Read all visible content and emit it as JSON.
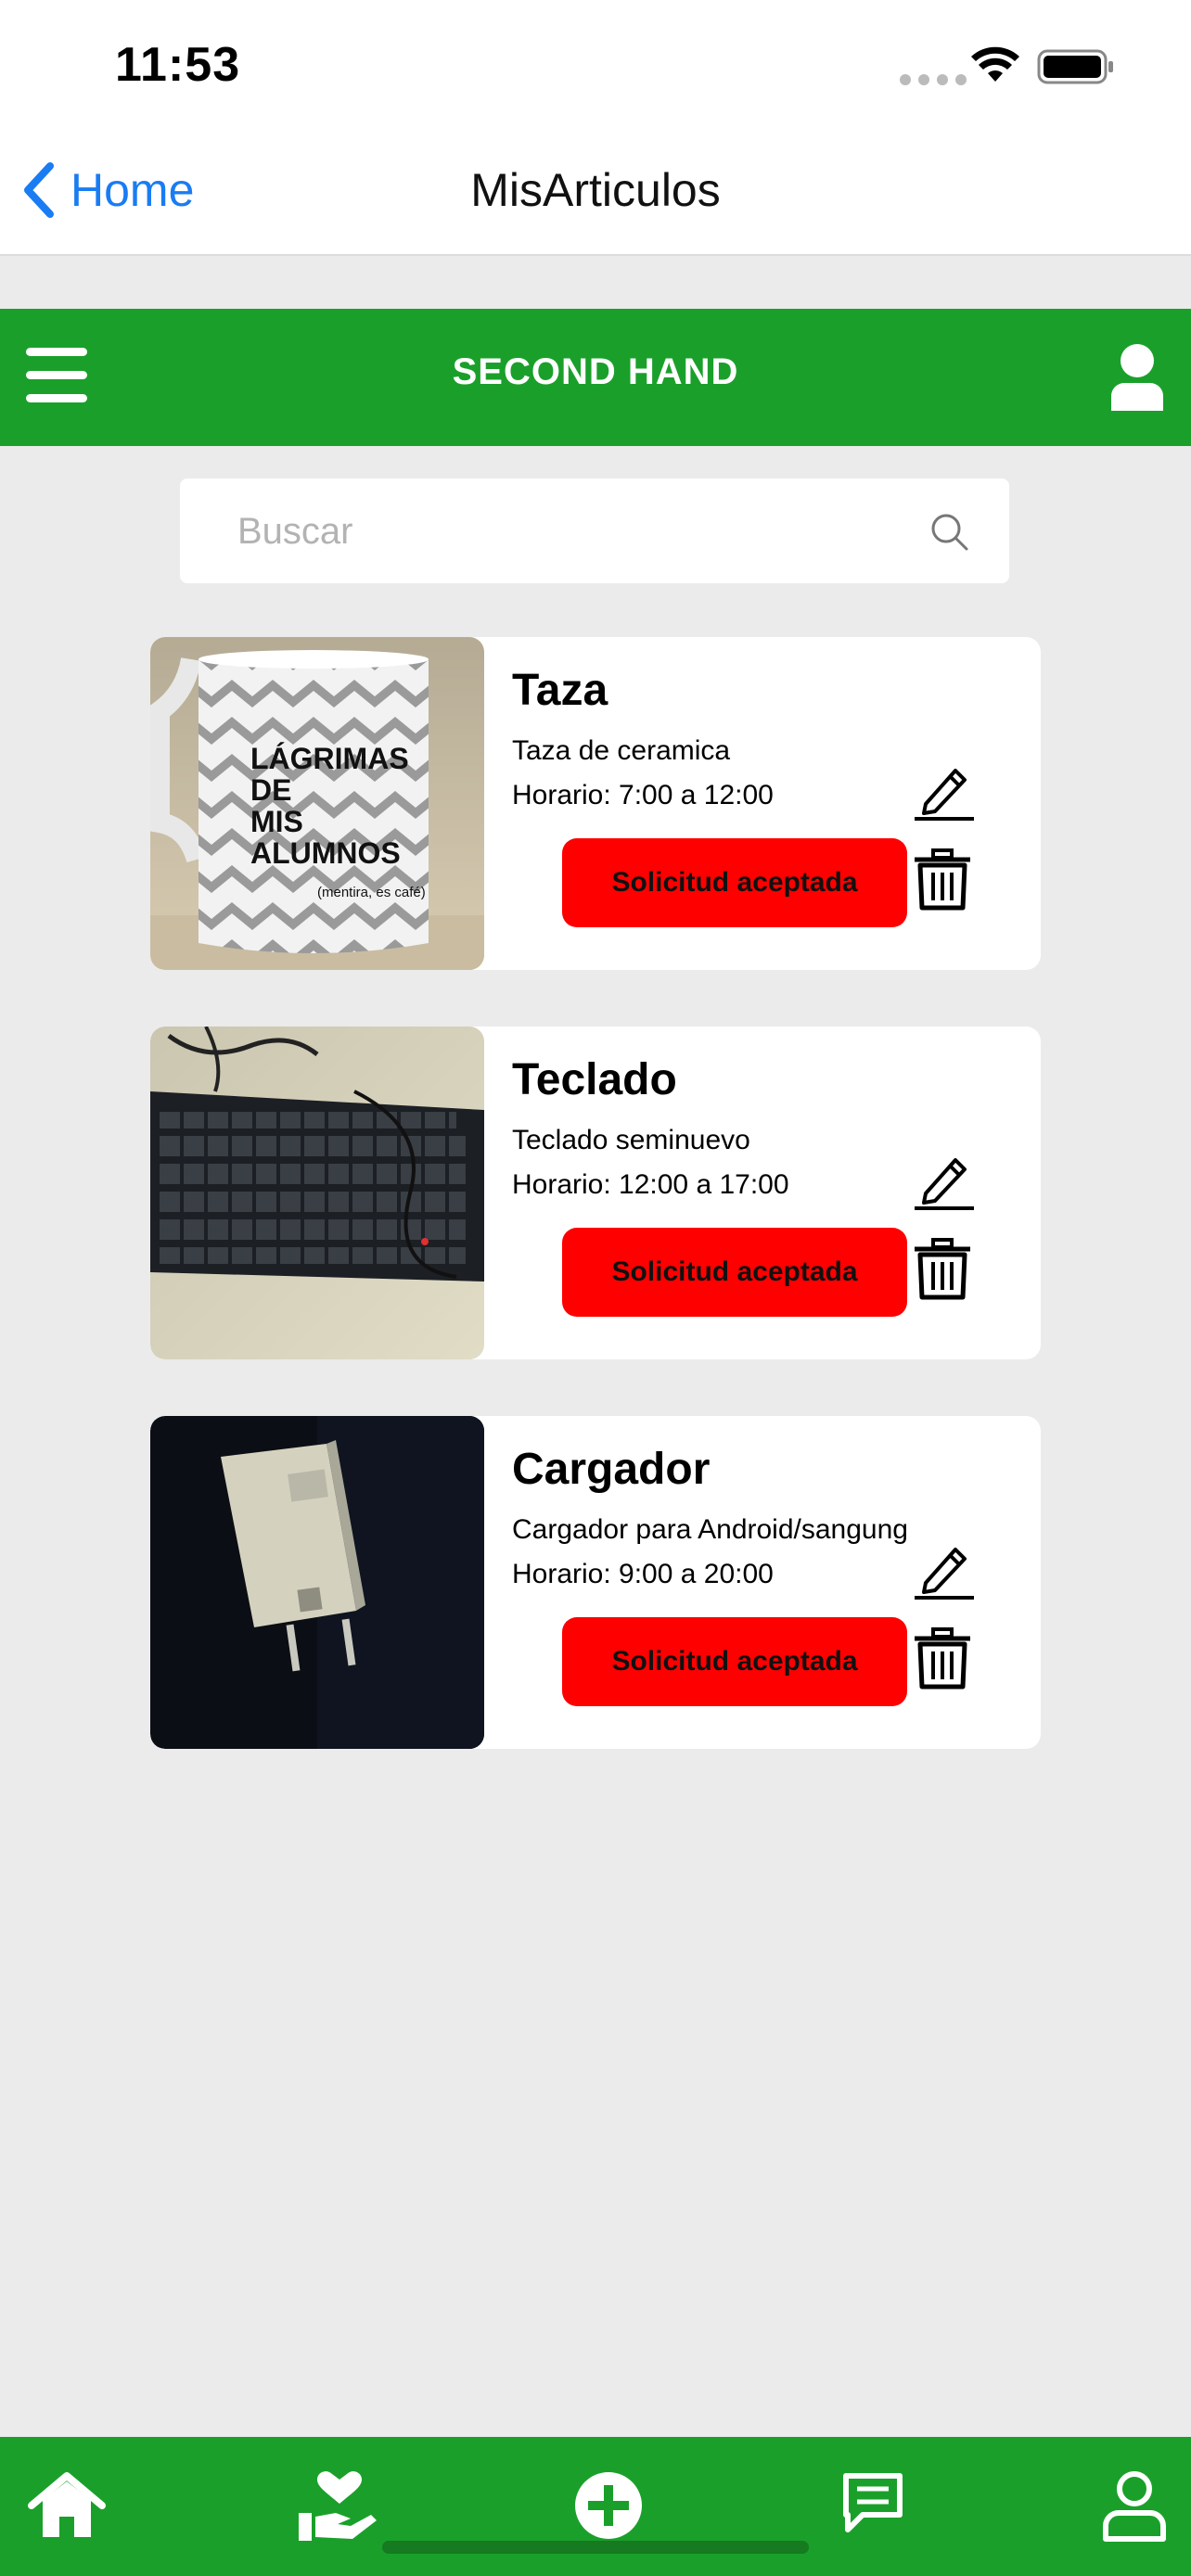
{
  "status_bar": {
    "time": "11:53"
  },
  "nav": {
    "back_label": "Home",
    "title": "MisArticulos"
  },
  "header": {
    "title": "SECOND HAND"
  },
  "search": {
    "placeholder": "Buscar"
  },
  "colors": {
    "brand_green": "#1aa02a",
    "button_red": "#ff0000",
    "ios_blue": "#1a7cf2",
    "background": "#ebebeb"
  },
  "items": [
    {
      "title": "Taza",
      "description": "Taza de ceramica",
      "hours": "Horario: 7:00 a 12:00",
      "status": "Solicitud aceptada",
      "image_text": [
        "LÁGRIMAS",
        "DE",
        "MIS",
        "ALUMNOS",
        "(mentira, es café)"
      ]
    },
    {
      "title": "Teclado",
      "description": "Teclado seminuevo",
      "hours": "Horario: 12:00 a 17:00",
      "status": "Solicitud aceptada"
    },
    {
      "title": "Cargador",
      "description": "Cargador para Android/sangung",
      "hours": "Horario: 9:00 a 20:00",
      "status": "Solicitud aceptada"
    }
  ],
  "tabs": [
    "home-icon",
    "donate-icon",
    "add-icon",
    "chat-icon",
    "profile-icon"
  ]
}
